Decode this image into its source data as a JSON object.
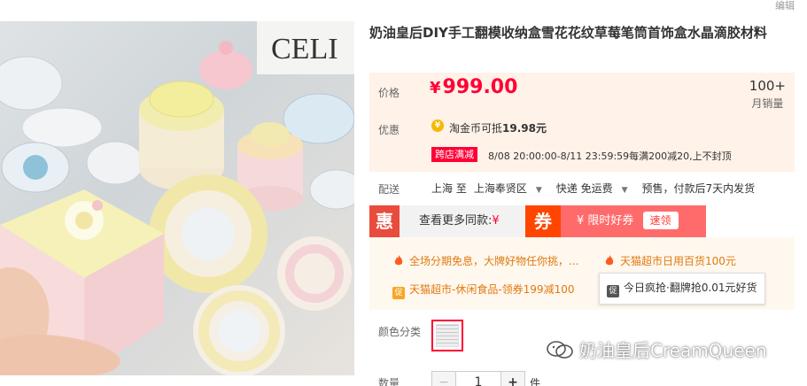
{
  "header": {
    "edit_label": "编辑"
  },
  "photo": {
    "brand_text": "CELI"
  },
  "product": {
    "title": "奶油皇后DIY手工翻模收纳盒雪花花纹草莓笔筒首饰盒水晶滴胶材料"
  },
  "price": {
    "label": "价格",
    "currency": "¥",
    "value": "999.00",
    "sold_count": "100+",
    "sold_label": "月销量"
  },
  "promotions": {
    "label": "优惠",
    "coin_text": "淘金币可抵",
    "coin_amount": "19.98元",
    "cross_store_tag": "跨店满减",
    "cross_store_text": "8/08 20:00:00-8/11 23:59:59每满200减20,上不封顶"
  },
  "shipping": {
    "label": "配送",
    "from": "上海 至",
    "to": "上海奉贤区",
    "carrier": "快递 免运费",
    "presale": "预售，付款后7天内发货"
  },
  "coupon_strip": {
    "hui_badge": "惠",
    "more_label": "查看更多同款:",
    "more_yen": "¥",
    "quan_badge": "券",
    "quan_text": "¥ 限时好券",
    "quan_button": "速领"
  },
  "activities": [
    {
      "text": "全场分期免息，大牌好物任你挑，..."
    },
    {
      "text": "天猫超市日用百货100元"
    },
    {
      "text": "天猫超市-休闲食品-领券199减100"
    },
    {
      "text": "今日疯抢·翻牌抢0.01元好货"
    }
  ],
  "sku": {
    "color_label": "颜色分类",
    "qty_label": "数量",
    "minus": "−",
    "qty_value": "1",
    "plus": "+",
    "unit": "件"
  },
  "watermark": {
    "text": "奶油皇后CreamQueen"
  },
  "colors": {
    "accent": "#ff0036",
    "price_bg": "#fff2e8",
    "activity_bg": "#fff8ee"
  }
}
